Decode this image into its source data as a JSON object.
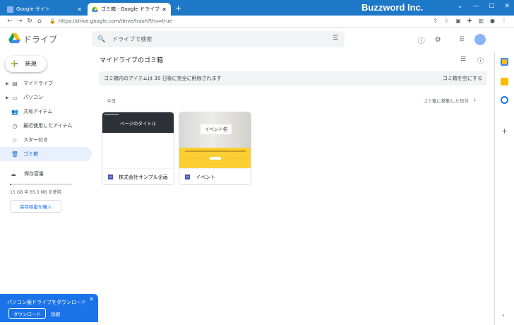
{
  "browser": {
    "tabs": [
      {
        "title": "Google サイト",
        "active": false
      },
      {
        "title": "ゴミ箱 - Google ドライブ",
        "active": true
      }
    ],
    "new_tab": "+",
    "brand": "Buzzword Inc.",
    "url": "https://drive.google.com/drive/trash?ths=true"
  },
  "app": {
    "name": "ドライブ",
    "search_placeholder": "ドライブで検索",
    "new_button": "新規"
  },
  "sidebar": {
    "items": [
      {
        "label": "マイドライブ",
        "icon": "my-drive-icon",
        "expandable": true
      },
      {
        "label": "パソコン",
        "icon": "computer-icon",
        "expandable": true
      },
      {
        "label": "共有アイテム",
        "icon": "shared-icon",
        "expandable": false
      },
      {
        "label": "最近使用したアイテム",
        "icon": "recent-icon",
        "expandable": false
      },
      {
        "label": "スター付き",
        "icon": "star-icon",
        "expandable": false
      },
      {
        "label": "ゴミ箱",
        "icon": "trash-icon",
        "expandable": false,
        "active": true
      }
    ],
    "storage": {
      "label": "保存容量",
      "used_text": "15 GB 中 65.3 MB を使用",
      "used_fraction": 0.004,
      "buy_label": "保存容量を購入"
    }
  },
  "main": {
    "title": "マイドライブのゴミ箱",
    "banner_text": "ゴミ箱内のアイテムは 30 日後に完全に削除されます",
    "empty_trash": "ゴミ箱を空にする",
    "group_label": "今日",
    "sort_label": "ゴミ箱に移動した日付",
    "files": [
      {
        "name": "株式会社サンプル企画",
        "thumb_text": "ページのタイトル"
      },
      {
        "name": "イベント",
        "thumb_text": "イベント名"
      }
    ]
  },
  "promo": {
    "text": "パソコン版ドライブをダウンロード",
    "download": "ダウンロード",
    "details": "詳細"
  },
  "colors": {
    "accent": "#1a73e8",
    "tabbar": "#1e78c8",
    "active_nav_bg": "#e8f0fe"
  }
}
